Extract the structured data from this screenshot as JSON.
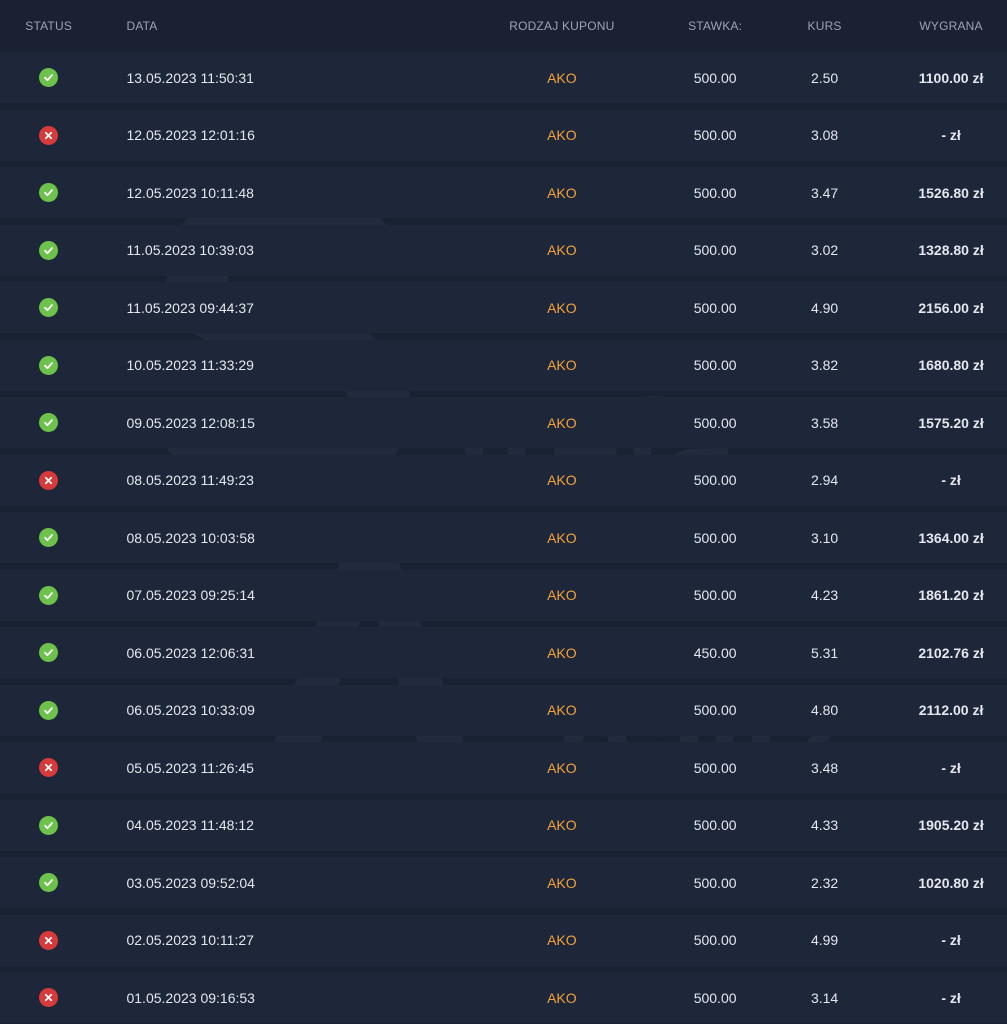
{
  "header": {
    "status": "STATUS",
    "date": "DATA",
    "type": "RODZAJ KUPONU",
    "stake": "STAWKA:",
    "odds": "KURS",
    "win": "WYGRANA"
  },
  "watermark": {
    "letter_s": "S",
    "word_1": "trefa",
    "letter_a": "A",
    "word_2": "naliz"
  },
  "colors": {
    "win": "#6cc24a",
    "loss": "#d63a3a",
    "accent": "#f2a23a",
    "background": "#1a2132"
  },
  "rows": [
    {
      "status": "win",
      "date": "13.05.2023 11:50:31",
      "type": "AKO",
      "stake": "500.00",
      "odds": "2.50",
      "win": "1100.00 zł"
    },
    {
      "status": "loss",
      "date": "12.05.2023 12:01:16",
      "type": "AKO",
      "stake": "500.00",
      "odds": "3.08",
      "win": "- zł"
    },
    {
      "status": "win",
      "date": "12.05.2023 10:11:48",
      "type": "AKO",
      "stake": "500.00",
      "odds": "3.47",
      "win": "1526.80 zł"
    },
    {
      "status": "win",
      "date": "11.05.2023 10:39:03",
      "type": "AKO",
      "stake": "500.00",
      "odds": "3.02",
      "win": "1328.80 zł"
    },
    {
      "status": "win",
      "date": "11.05.2023 09:44:37",
      "type": "AKO",
      "stake": "500.00",
      "odds": "4.90",
      "win": "2156.00 zł"
    },
    {
      "status": "win",
      "date": "10.05.2023 11:33:29",
      "type": "AKO",
      "stake": "500.00",
      "odds": "3.82",
      "win": "1680.80 zł"
    },
    {
      "status": "win",
      "date": "09.05.2023 12:08:15",
      "type": "AKO",
      "stake": "500.00",
      "odds": "3.58",
      "win": "1575.20 zł"
    },
    {
      "status": "loss",
      "date": "08.05.2023 11:49:23",
      "type": "AKO",
      "stake": "500.00",
      "odds": "2.94",
      "win": "- zł"
    },
    {
      "status": "win",
      "date": "08.05.2023 10:03:58",
      "type": "AKO",
      "stake": "500.00",
      "odds": "3.10",
      "win": "1364.00 zł"
    },
    {
      "status": "win",
      "date": "07.05.2023 09:25:14",
      "type": "AKO",
      "stake": "500.00",
      "odds": "4.23",
      "win": "1861.20 zł"
    },
    {
      "status": "win",
      "date": "06.05.2023 12:06:31",
      "type": "AKO",
      "stake": "450.00",
      "odds": "5.31",
      "win": "2102.76 zł"
    },
    {
      "status": "win",
      "date": "06.05.2023 10:33:09",
      "type": "AKO",
      "stake": "500.00",
      "odds": "4.80",
      "win": "2112.00 zł"
    },
    {
      "status": "loss",
      "date": "05.05.2023 11:26:45",
      "type": "AKO",
      "stake": "500.00",
      "odds": "3.48",
      "win": "- zł"
    },
    {
      "status": "win",
      "date": "04.05.2023 11:48:12",
      "type": "AKO",
      "stake": "500.00",
      "odds": "4.33",
      "win": "1905.20 zł"
    },
    {
      "status": "win",
      "date": "03.05.2023 09:52:04",
      "type": "AKO",
      "stake": "500.00",
      "odds": "2.32",
      "win": "1020.80 zł"
    },
    {
      "status": "loss",
      "date": "02.05.2023 10:11:27",
      "type": "AKO",
      "stake": "500.00",
      "odds": "4.99",
      "win": "- zł"
    },
    {
      "status": "loss",
      "date": "01.05.2023 09:16:53",
      "type": "AKO",
      "stake": "500.00",
      "odds": "3.14",
      "win": "- zł"
    }
  ]
}
